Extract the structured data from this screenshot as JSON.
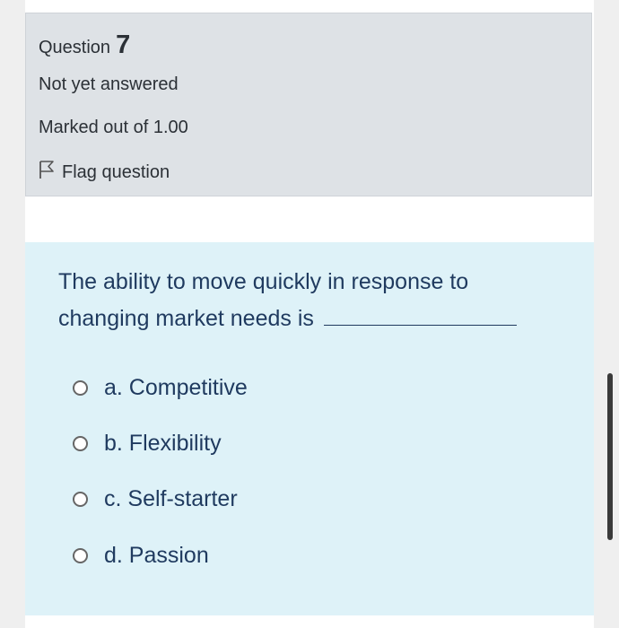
{
  "question_info": {
    "label": "Question",
    "number": "7",
    "state": "Not yet answered",
    "grade": "Marked out of 1.00",
    "flag_label": "Flag question"
  },
  "question": {
    "text": "The ability to move quickly in response to changing market needs is",
    "options": [
      {
        "label": "a. Competitive",
        "selected": false
      },
      {
        "label": "b. Flexibility",
        "selected": false
      },
      {
        "label": "c. Self-starter",
        "selected": false
      },
      {
        "label": "d. Passion",
        "selected": false
      }
    ]
  },
  "colors": {
    "info_background": "#dee2e6",
    "question_background": "#def2f8",
    "question_text": "#1f3a5f"
  }
}
